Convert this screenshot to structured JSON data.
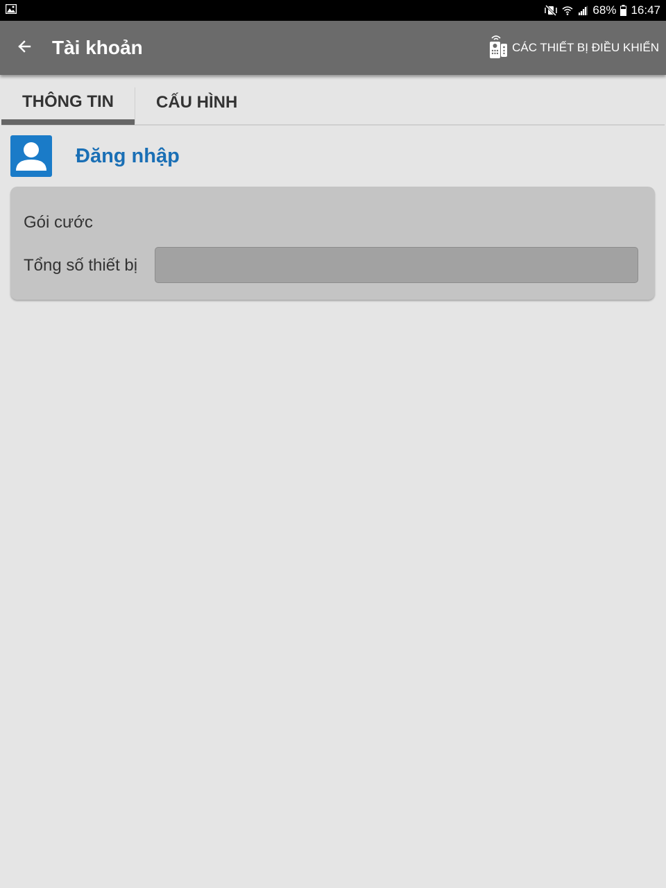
{
  "status_bar": {
    "left_icon": "picture-icon",
    "icons": [
      "mute-vibrate-icon",
      "wifi-icon",
      "signal-icon"
    ],
    "battery": "68%",
    "time": "16:47"
  },
  "app_bar": {
    "back_icon": "arrow-left-icon",
    "title": "Tài khoản",
    "action_icon": "remote-control-icon",
    "action_label": "CÁC THIẾT BỊ ĐIỀU KHIỂN"
  },
  "tabs": [
    {
      "label": "THÔNG TIN",
      "active": true
    },
    {
      "label": "CẤU HÌNH",
      "active": false
    }
  ],
  "login": {
    "icon": "user-avatar-icon",
    "label": "Đăng nhập"
  },
  "info_card": {
    "package_label": "Gói cước",
    "package_value": "",
    "device_total_label": "Tổng số thiết bị",
    "device_total_value": ""
  },
  "colors": {
    "app_bar": "#6b6b6b",
    "accent_blue": "#1a7bc8",
    "background": "#e5e5e5",
    "card": "#c4c4c4"
  }
}
